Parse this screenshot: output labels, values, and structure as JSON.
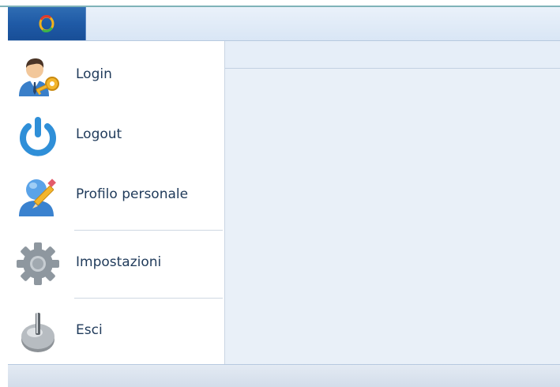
{
  "app_button": {
    "icon": "office-logo-icon"
  },
  "menu": {
    "items": [
      {
        "label": "Login",
        "icon": "user-key-icon"
      },
      {
        "label": "Logout",
        "icon": "power-icon"
      },
      {
        "label": "Profilo personale",
        "icon": "user-edit-icon"
      },
      {
        "label": "Impostazioni",
        "icon": "gear-icon"
      },
      {
        "label": "Esci",
        "icon": "exit-icon"
      }
    ]
  },
  "colors": {
    "app_button": "#1f5aa6",
    "ribbon": "#dfe9f6",
    "pane": "#e9f0f8",
    "label": "#1f3a5a",
    "power_blue": "#2f8fd8",
    "key_gold": "#e0a21a"
  }
}
